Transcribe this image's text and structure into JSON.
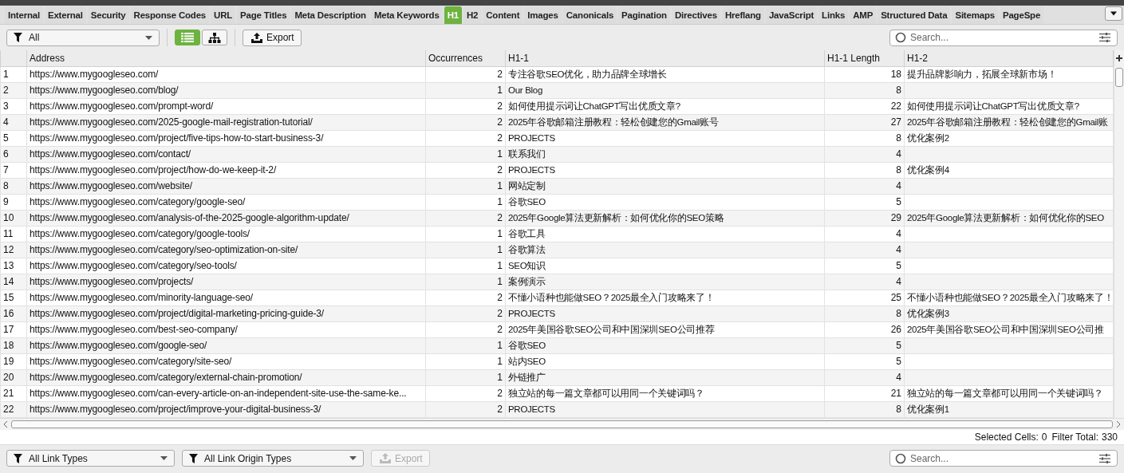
{
  "tabs": [
    {
      "label": "Internal",
      "selected": false
    },
    {
      "label": "External",
      "selected": false
    },
    {
      "label": "Security",
      "selected": false
    },
    {
      "label": "Response Codes",
      "selected": false
    },
    {
      "label": "URL",
      "selected": false
    },
    {
      "label": "Page Titles",
      "selected": false
    },
    {
      "label": "Meta Description",
      "selected": false
    },
    {
      "label": "Meta Keywords",
      "selected": false
    },
    {
      "label": "H1",
      "selected": true
    },
    {
      "label": "H2",
      "selected": false
    },
    {
      "label": "Content",
      "selected": false
    },
    {
      "label": "Images",
      "selected": false
    },
    {
      "label": "Canonicals",
      "selected": false
    },
    {
      "label": "Pagination",
      "selected": false
    },
    {
      "label": "Directives",
      "selected": false
    },
    {
      "label": "Hreflang",
      "selected": false
    },
    {
      "label": "JavaScript",
      "selected": false
    },
    {
      "label": "Links",
      "selected": false
    },
    {
      "label": "AMP",
      "selected": false
    },
    {
      "label": "Structured Data",
      "selected": false
    },
    {
      "label": "Sitemaps",
      "selected": false
    },
    {
      "label": "PageSpe",
      "selected": false
    }
  ],
  "toolbar": {
    "filter": "All",
    "views": [
      {
        "kind": "list",
        "selected": true
      },
      {
        "kind": "tree",
        "selected": false
      }
    ],
    "export": {
      "label": "Export",
      "disabled": false
    },
    "search": {
      "placeholder": "Search..."
    }
  },
  "table": {
    "columns": [
      "Address",
      "Occurrences",
      "H1-1",
      "H1-1 Length",
      "H1-2"
    ],
    "rows": [
      {
        "num": "1",
        "address": "https://www.mygoogleseo.com/",
        "occurrences": "2",
        "h1_1": "专注谷歌SEO优化，助力品牌全球增长",
        "h1_1_length": "18",
        "h1_2": "提升品牌影响力，拓展全球新市场！"
      },
      {
        "num": "2",
        "address": "https://www.mygoogleseo.com/blog/",
        "occurrences": "1",
        "h1_1": "Our Blog",
        "h1_1_length": "8",
        "h1_2": ""
      },
      {
        "num": "3",
        "address": "https://www.mygoogleseo.com/prompt-word/",
        "occurrences": "2",
        "h1_1": "如何使用提示词让ChatGPT写出优质文章?",
        "h1_1_length": "22",
        "h1_2": "如何使用提示词让ChatGPT写出优质文章?"
      },
      {
        "num": "4",
        "address": "https://www.mygoogleseo.com/2025-google-mail-registration-tutorial/",
        "occurrences": "2",
        "h1_1": "2025年谷歌邮箱注册教程：轻松创建您的Gmail账号",
        "h1_1_length": "27",
        "h1_2": "2025年谷歌邮箱注册教程：轻松创建您的Gmail账"
      },
      {
        "num": "5",
        "address": "https://www.mygoogleseo.com/project/five-tips-how-to-start-business-3/",
        "occurrences": "2",
        "h1_1": "PROJECTS",
        "h1_1_length": "8",
        "h1_2": "优化案例2"
      },
      {
        "num": "6",
        "address": "https://www.mygoogleseo.com/contact/",
        "occurrences": "1",
        "h1_1": "联系我们",
        "h1_1_length": "4",
        "h1_2": ""
      },
      {
        "num": "7",
        "address": "https://www.mygoogleseo.com/project/how-do-we-keep-it-2/",
        "occurrences": "2",
        "h1_1": "PROJECTS",
        "h1_1_length": "8",
        "h1_2": "优化案例4"
      },
      {
        "num": "8",
        "address": "https://www.mygoogleseo.com/website/",
        "occurrences": "1",
        "h1_1": "网站定制",
        "h1_1_length": "4",
        "h1_2": ""
      },
      {
        "num": "9",
        "address": "https://www.mygoogleseo.com/category/google-seo/",
        "occurrences": "1",
        "h1_1": "谷歌SEO",
        "h1_1_length": "5",
        "h1_2": ""
      },
      {
        "num": "10",
        "address": "https://www.mygoogleseo.com/analysis-of-the-2025-google-algorithm-update/",
        "occurrences": "2",
        "h1_1": "2025年Google算法更新解析：如何优化你的SEO策略",
        "h1_1_length": "29",
        "h1_2": "2025年Google算法更新解析：如何优化你的SEO"
      },
      {
        "num": "11",
        "address": "https://www.mygoogleseo.com/category/google-tools/",
        "occurrences": "1",
        "h1_1": "谷歌工具",
        "h1_1_length": "4",
        "h1_2": ""
      },
      {
        "num": "12",
        "address": "https://www.mygoogleseo.com/category/seo-optimization-on-site/",
        "occurrences": "1",
        "h1_1": "谷歌算法",
        "h1_1_length": "4",
        "h1_2": ""
      },
      {
        "num": "13",
        "address": "https://www.mygoogleseo.com/category/seo-tools/",
        "occurrences": "1",
        "h1_1": "SEO知识",
        "h1_1_length": "5",
        "h1_2": ""
      },
      {
        "num": "14",
        "address": "https://www.mygoogleseo.com/projects/",
        "occurrences": "1",
        "h1_1": "案例演示",
        "h1_1_length": "4",
        "h1_2": ""
      },
      {
        "num": "15",
        "address": "https://www.mygoogleseo.com/minority-language-seo/",
        "occurrences": "2",
        "h1_1": "不懂小语种也能做SEO？2025最全入门攻略来了！",
        "h1_1_length": "25",
        "h1_2": "不懂小语种也能做SEO？2025最全入门攻略来了！"
      },
      {
        "num": "16",
        "address": "https://www.mygoogleseo.com/project/digital-marketing-pricing-guide-3/",
        "occurrences": "2",
        "h1_1": "PROJECTS",
        "h1_1_length": "8",
        "h1_2": "优化案例3"
      },
      {
        "num": "17",
        "address": "https://www.mygoogleseo.com/best-seo-company/",
        "occurrences": "2",
        "h1_1": "2025年美国谷歌SEO公司和中国深圳SEO公司推荐",
        "h1_1_length": "26",
        "h1_2": "2025年美国谷歌SEO公司和中国深圳SEO公司推"
      },
      {
        "num": "18",
        "address": "https://www.mygoogleseo.com/google-seo/",
        "occurrences": "1",
        "h1_1": "谷歌SEO",
        "h1_1_length": "5",
        "h1_2": ""
      },
      {
        "num": "19",
        "address": "https://www.mygoogleseo.com/category/site-seo/",
        "occurrences": "1",
        "h1_1": "站内SEO",
        "h1_1_length": "5",
        "h1_2": ""
      },
      {
        "num": "20",
        "address": "https://www.mygoogleseo.com/category/external-chain-promotion/",
        "occurrences": "1",
        "h1_1": "外链推广",
        "h1_1_length": "4",
        "h1_2": ""
      },
      {
        "num": "21",
        "address": "https://www.mygoogleseo.com/can-every-article-on-an-independent-site-use-the-same-ke...",
        "occurrences": "2",
        "h1_1": "独立站的每一篇文章都可以用同一个关键词吗？",
        "h1_1_length": "21",
        "h1_2": "独立站的每一篇文章都可以用同一个关键词吗？"
      },
      {
        "num": "22",
        "address": "https://www.mygoogleseo.com/project/improve-your-digital-business-3/",
        "occurrences": "2",
        "h1_1": "PROJECTS",
        "h1_1_length": "8",
        "h1_2": "优化案例1"
      }
    ]
  },
  "status_bar": {
    "selected_cells_label": "Selected Cells:",
    "selected_cells": "0",
    "filter_total_label": "Filter Total:",
    "filter_total": "330"
  },
  "bottom_toolbar": {
    "filters": [
      "All Link Types",
      "All Link Origin Types"
    ],
    "export": {
      "label": "Export",
      "disabled": true
    },
    "search": {
      "placeholder": "Search..."
    }
  }
}
